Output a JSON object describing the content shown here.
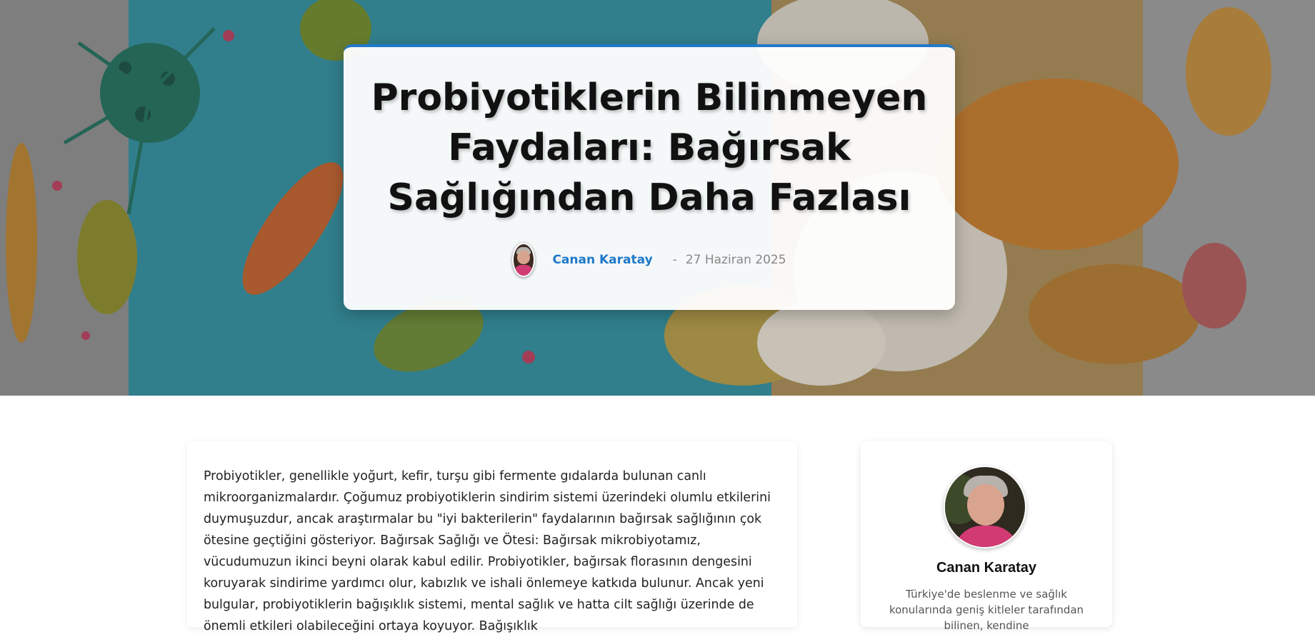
{
  "hero": {
    "image": "probiotic-bacteria-and-fermented-foods-illustration",
    "title": "Probiyotiklerin Bilinmeyen Faydaları: Bağırsak Sağlığından Daha Fazlası",
    "author_avatar": "author-avatar-photo",
    "author": "Canan Karatay",
    "separator": "-",
    "date": "27 Haziran 2025",
    "accent_color": "#1f79c9"
  },
  "article": {
    "body": "Probiyotikler, genellikle yoğurt, kefir, turşu gibi fermente gıdalarda bulunan canlı mikroorganizmalardır. Çoğumuz probiyotiklerin sindirim sistemi üzerindeki olumlu etkilerini duymuşuzdur, ancak araştırmalar bu \"iyi bakterilerin\" faydalarının bağırsak sağlığının çok ötesine geçtiğini gösteriyor.   Bağırsak Sağlığı ve Ötesi: Bağırsak mikrobiyotamız, vücudumuzun ikinci beyni olarak kabul edilir. Probiyotikler, bağırsak florasının dengesini koruyarak sindirime yardımcı olur, kabızlık ve ishali önlemeye katkıda bulunur. Ancak yeni bulgular, probiyotiklerin bağışıklık sistemi, mental sağlık ve hatta cilt sağlığı üzerinde de önemli etkileri olabileceğini ortaya koyuyor.  Bağışıklık"
  },
  "author_card": {
    "avatar": "author-portrait-photo",
    "name": "Canan Karatay",
    "bio": "Türkiye'de beslenme ve sağlık konularında geniş kitleler tarafından bilinen, kendine"
  }
}
